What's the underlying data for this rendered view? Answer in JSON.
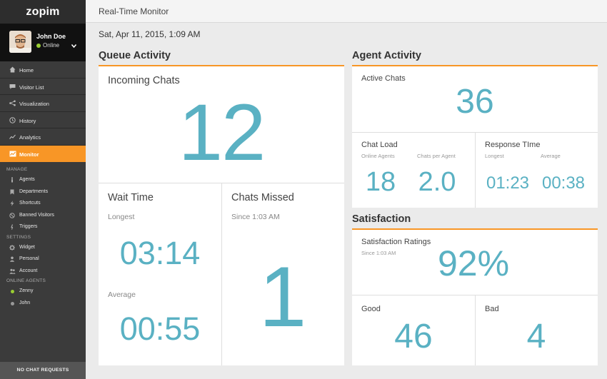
{
  "app": {
    "logo": "zopim"
  },
  "user": {
    "name": "John Doe",
    "status": "Online"
  },
  "nav": {
    "items": [
      {
        "label": "Home",
        "icon": "home-icon"
      },
      {
        "label": "Visitor List",
        "icon": "chat-bubble-icon"
      },
      {
        "label": "Visualization",
        "icon": "network-icon"
      },
      {
        "label": "History",
        "icon": "clock-icon"
      },
      {
        "label": "Analytics",
        "icon": "trend-icon"
      },
      {
        "label": "Monitor",
        "icon": "monitor-icon",
        "active": true
      }
    ],
    "manage_title": "MANAGE",
    "manage": [
      {
        "label": "Agents",
        "icon": "person-icon"
      },
      {
        "label": "Departments",
        "icon": "bookmark-icon"
      },
      {
        "label": "Shortcuts",
        "icon": "lightning-icon"
      },
      {
        "label": "Banned Visitors",
        "icon": "ban-icon"
      },
      {
        "label": "Triggers",
        "icon": "trigger-icon"
      }
    ],
    "settings_title": "SETTINGS",
    "settings": [
      {
        "label": "Widget",
        "icon": "gear-icon"
      },
      {
        "label": "Personal",
        "icon": "person-icon"
      },
      {
        "label": "Account",
        "icon": "people-icon"
      }
    ],
    "online_agents_title": "ONLINE AGENTS",
    "online_agents": [
      {
        "label": "Zenny",
        "status_color": "#9acd32"
      },
      {
        "label": "John",
        "status_color": "#999999"
      }
    ],
    "footer": "NO CHAT REQUESTS"
  },
  "header": {
    "title": "Real-Time Monitor"
  },
  "datetime": "Sat, Apr 11, 2015, 1:09 AM",
  "queue": {
    "title": "Queue Activity",
    "incoming": {
      "label": "Incoming Chats",
      "value": "12"
    },
    "wait": {
      "label": "Wait Time",
      "longest_label": "Longest",
      "longest": "03:14",
      "average_label": "Average",
      "average": "00:55"
    },
    "missed": {
      "label": "Chats Missed",
      "since": "Since 1:03 AM",
      "value": "1"
    }
  },
  "agent": {
    "title": "Agent Activity",
    "active": {
      "label": "Active Chats",
      "value": "36"
    },
    "load": {
      "label": "Chat Load",
      "online_label": "Online Agents",
      "online": "18",
      "per_label": "Chats per Agent",
      "per": "2.0"
    },
    "response": {
      "label": "Response TIme",
      "longest_label": "Longest",
      "longest": "01:23",
      "average_label": "Average",
      "average": "00:38"
    }
  },
  "satisfaction": {
    "title": "Satisfaction",
    "ratings": {
      "label": "Satisfaction Ratings",
      "since": "Since 1:03 AM",
      "value": "92%"
    },
    "good": {
      "label": "Good",
      "value": "46"
    },
    "bad": {
      "label": "Bad",
      "value": "4"
    }
  },
  "colors": {
    "accent": "#f89626",
    "value": "#5ab1c3",
    "sidebar": "#3b3b3b"
  }
}
